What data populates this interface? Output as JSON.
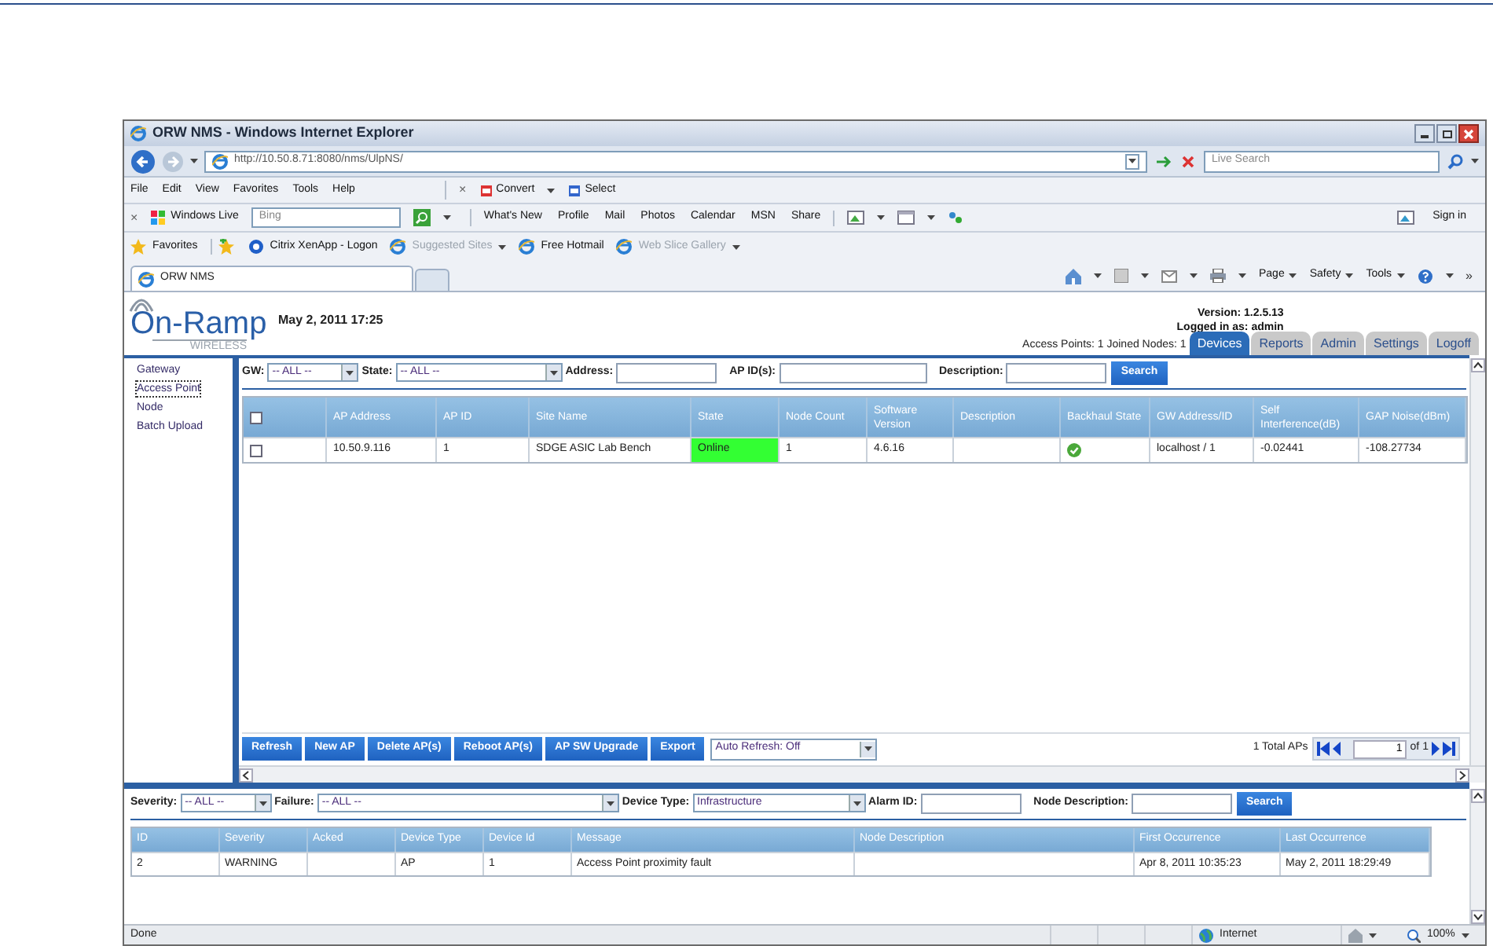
{
  "window": {
    "title": "ORW NMS - Windows Internet Explorer"
  },
  "address_bar": {
    "url": "http://10.50.8.71:8080/nms/UlpNS/",
    "search_placeholder": "Live Search"
  },
  "menu": [
    "File",
    "Edit",
    "View",
    "Favorites",
    "Tools",
    "Help"
  ],
  "convert_toolbar": {
    "close": "×",
    "items": [
      "Convert",
      "Select"
    ]
  },
  "live_toolbar": {
    "close": "×",
    "brand": "Windows Live",
    "search_value": "Bing",
    "links": [
      "What's New",
      "Profile",
      "Mail",
      "Photos",
      "Calendar",
      "MSN",
      "Share"
    ],
    "sign_in": "Sign in"
  },
  "favorites_bar": {
    "label": "Favorites",
    "items": [
      {
        "label": "Citrix XenApp - Logon",
        "dimmed": false,
        "dropdown": false
      },
      {
        "label": "Suggested Sites",
        "dimmed": true,
        "dropdown": true
      },
      {
        "label": "Free Hotmail",
        "dimmed": false,
        "dropdown": false
      },
      {
        "label": "Web Slice Gallery",
        "dimmed": true,
        "dropdown": true
      }
    ]
  },
  "browser_tabs": [
    {
      "label": "ORW NMS",
      "selected": true
    }
  ],
  "command_bar": {
    "menus": [
      "Page",
      "Safety",
      "Tools"
    ],
    "more": "»"
  },
  "app_header": {
    "logo": "On-Ramp",
    "logo_sub": "WIRELESS",
    "date": "May 2, 2011 17:25",
    "version": "Version: 1.2.5.13",
    "logged_in": "Logged in as: admin",
    "counts": "Access Points: 1 Joined Nodes: 1",
    "tabs": [
      {
        "label": "Devices",
        "selected": true
      },
      {
        "label": "Reports",
        "selected": false
      },
      {
        "label": "Admin",
        "selected": false
      },
      {
        "label": "Settings",
        "selected": false
      },
      {
        "label": "Logoff",
        "selected": false
      }
    ]
  },
  "sidebar": {
    "items": [
      {
        "label": "Gateway",
        "selected": false
      },
      {
        "label": "Access Point",
        "selected": true
      },
      {
        "label": "Node",
        "selected": false
      },
      {
        "label": "Batch Upload",
        "selected": false
      }
    ]
  },
  "ap_filters": {
    "gw_label": "GW:",
    "gw_value": "-- ALL --",
    "state_label": "State:",
    "state_value": "-- ALL --",
    "address_label": "Address:",
    "apid_label": "AP ID(s):",
    "description_label": "Description:",
    "search": "Search"
  },
  "ap_table": {
    "select_all_checked": false,
    "columns": [
      "AP Address",
      "AP ID",
      "Site Name",
      "State",
      "Node Count",
      "Software Version",
      "Description",
      "Backhaul State",
      "GW Address/ID",
      "Self Interference(dB)",
      "GAP Noise(dBm)"
    ],
    "rows": [
      {
        "checked": false,
        "ap_address": "10.50.9.116",
        "ap_id": "1",
        "site_name": "SDGE ASIC Lab Bench",
        "state": "Online",
        "color": "#33ff33",
        "node_count": "1",
        "software_version": "4.6.16",
        "backhaul_ok": true,
        "gw": "localhost / 1",
        "self_interference": "-0.02441",
        "gap_noise": "-108.27734"
      }
    ]
  },
  "ap_actions": {
    "buttons": [
      "Refresh",
      "New AP",
      "Delete AP(s)",
      "Reboot AP(s)",
      "AP SW Upgrade",
      "Export"
    ],
    "auto_refresh": "Auto Refresh: Off",
    "total": "1 Total APs",
    "page": "1",
    "of": "of",
    "pages": "1"
  },
  "alarm_filters": {
    "severity_label": "Severity:",
    "severity_value": "-- ALL --",
    "failure_label": "Failure:",
    "failure_value": "-- ALL --",
    "device_type_label": "Device Type:",
    "device_type_value": "Infrastructure",
    "alarm_id_label": "Alarm ID:",
    "node_description_label": "Node Description:",
    "search": "Search"
  },
  "alarm_table": {
    "columns": [
      "ID",
      "Severity",
      "Acked",
      "Device Type",
      "Device Id",
      "Message",
      "Node Description",
      "First Occurrence",
      "Last Occurrence"
    ],
    "rows": [
      [
        "2",
        "WARNING",
        "",
        "AP",
        "1",
        "Access Point proximity fault",
        "",
        "Apr 8, 2011 10:35:23",
        "May 2, 2011 18:29:49"
      ]
    ]
  },
  "status_bar": {
    "text": "Done",
    "zone": "Internet",
    "zoom": "100%"
  }
}
